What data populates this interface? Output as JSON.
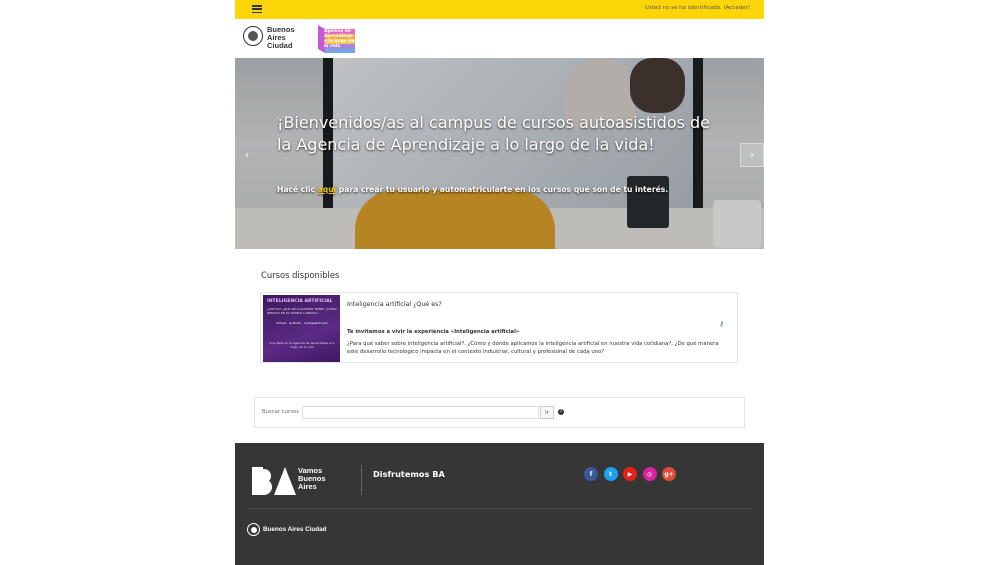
{
  "topbar": {
    "login_text": "Usted no se ha identificado.",
    "login_link": "(Acceder)"
  },
  "header": {
    "city_logo_text": "Buenos Aires Ciudad",
    "agency_logo_text": "Agencia de Aprendizaje a lo largo de la vida"
  },
  "hero": {
    "title": "¡Bienvenidos/as al campus de cursos autoasistidos de la Agencia de Aprendizaje a lo largo de la vida!",
    "subtitle_before": "Hacé clic ",
    "subtitle_link": "aquí",
    "subtitle_after": " para crear tu usuario y automatricularte en los cursos que son de tu interés.",
    "prev_icon": "chevron-left-icon",
    "next_icon": "chevron-right-icon"
  },
  "courses": {
    "title": "Cursos disponibles",
    "items": [
      {
        "name": "Inteligencia artificial ¿Qué es?",
        "image_title": "INTELIGENCIA ARTIFICIAL",
        "image_sub": "¿QUÉ ES? ¿QUÉ APLICACIONES TIENE? ¿CÓMO IMPACTA EN EL MUNDO LABORAL?",
        "image_mid": "Virtual · Gratuito · Autogestionado",
        "image_bottom": "Inscribite en la Agencia de Aprendizaje a lo largo de la vida",
        "desc_lead": "Te invitamos a vivir la experiencia «Inteligencia artificial»",
        "desc_body": "¿Para qué saber sobre inteligencia artificial?, ¿Cómo y dónde aplicamos la inteligencia artificial en nuestra vida cotidiana?, ¿De qué manera este desarrollo tecnológico impacta en el contexto industrial, cultural y profesional de cada uno?",
        "guest_icon": "key-icon"
      }
    ]
  },
  "search": {
    "label": "Buscar cursos",
    "value": "",
    "button_label": "Ir",
    "help_icon": "question-circle-icon"
  },
  "footer": {
    "vba_text": "Vamos Buenos Aires",
    "vba_mark": "BA",
    "tagline": "Disfrutemos BA",
    "socials": [
      {
        "name": "facebook",
        "glyph": "f",
        "color": "#3b5998"
      },
      {
        "name": "twitter",
        "glyph": "t",
        "color": "#1da1f2"
      },
      {
        "name": "youtube",
        "glyph": "▶",
        "color": "#e62117"
      },
      {
        "name": "instagram",
        "glyph": "◎",
        "color": "#d6249f"
      },
      {
        "name": "google-plus",
        "glyph": "g+",
        "color": "#dd4b39"
      }
    ],
    "city_text": "Buenos Aires Ciudad"
  }
}
